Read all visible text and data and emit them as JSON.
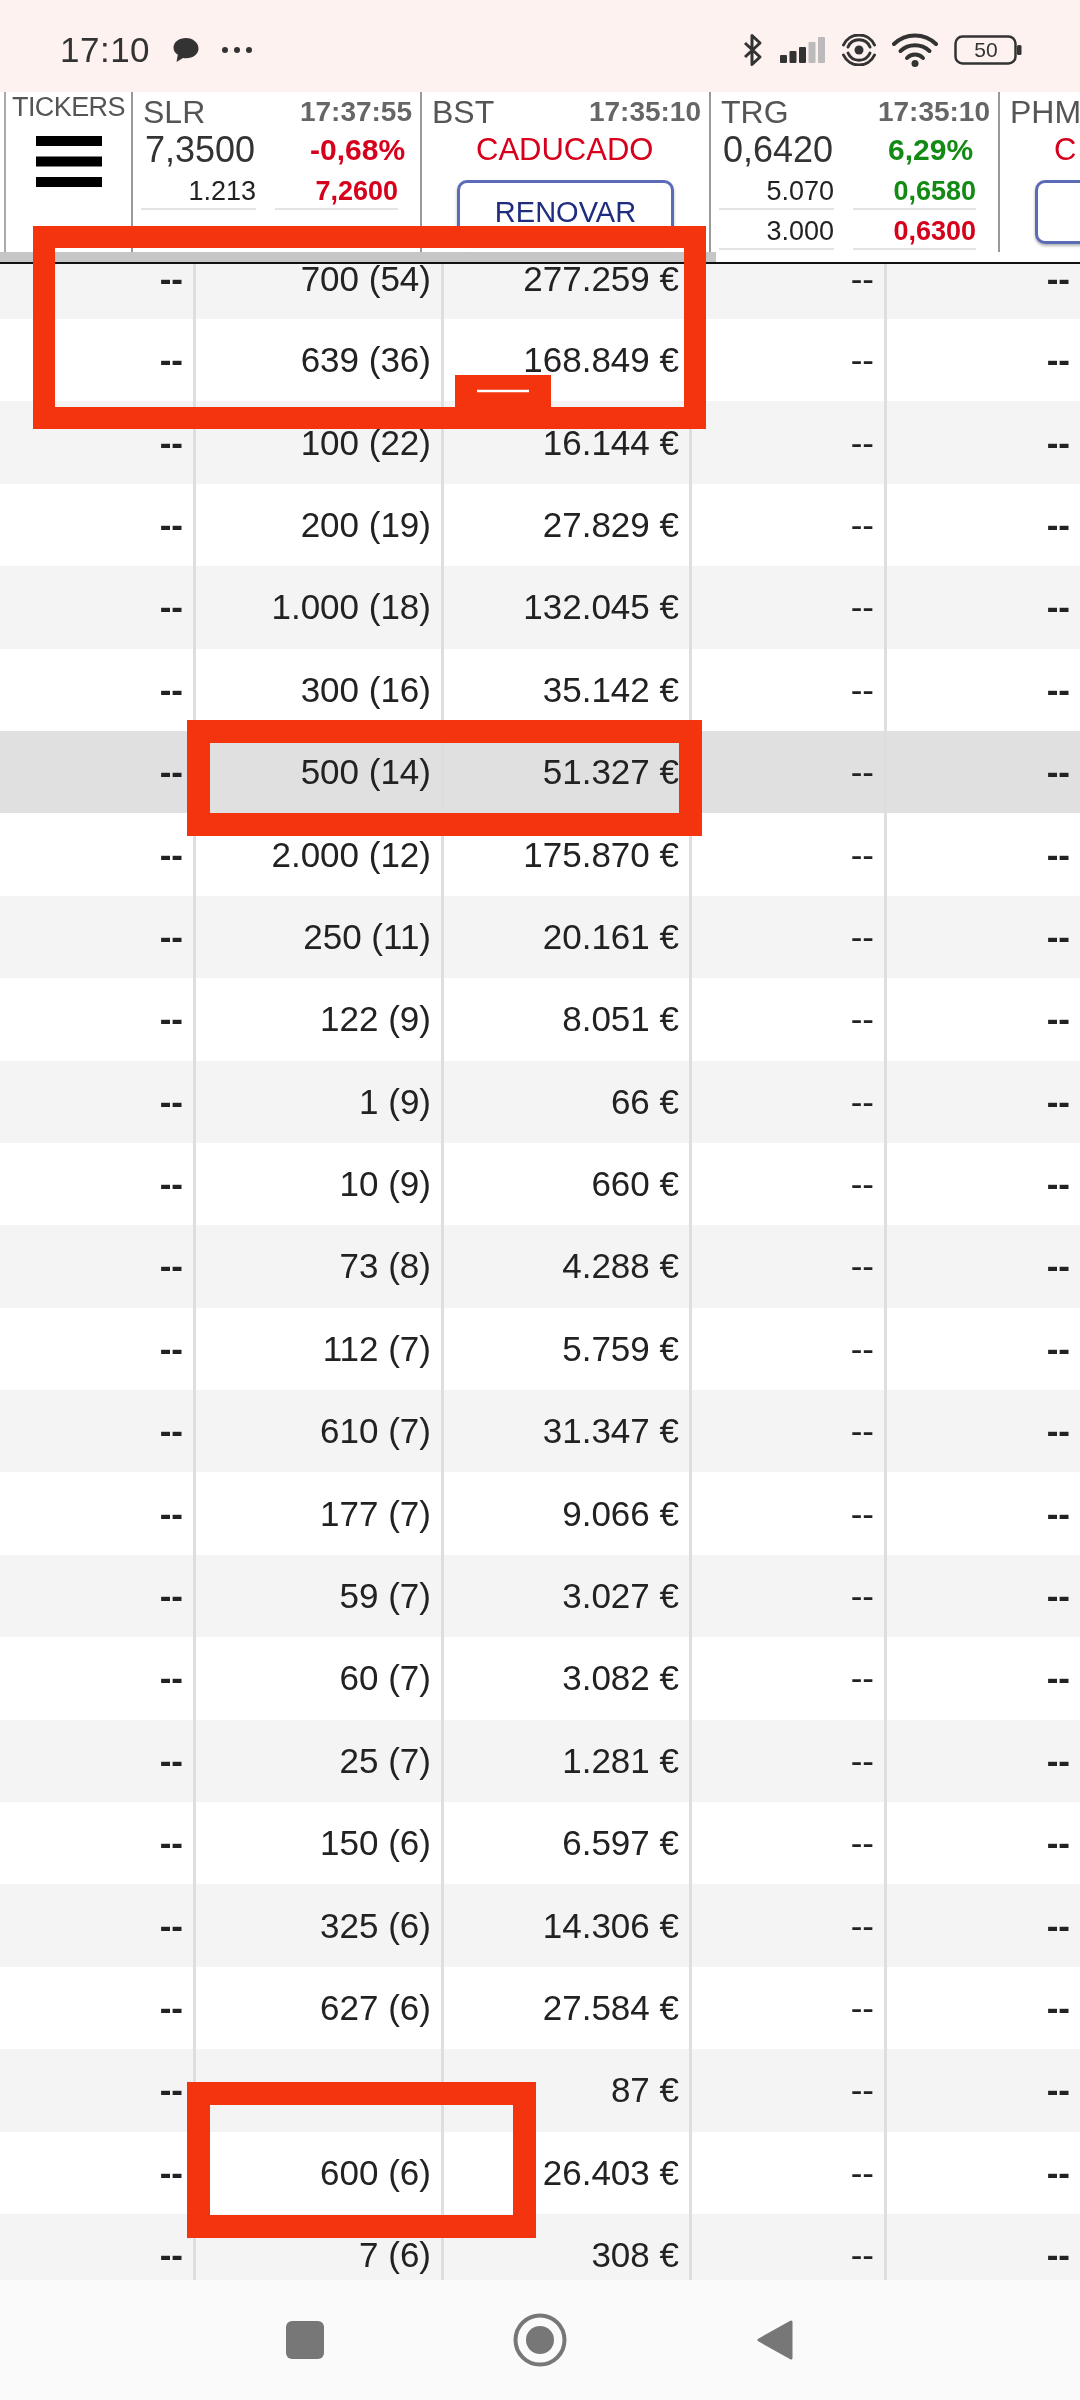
{
  "status_bar": {
    "time": "17:10",
    "battery": "50"
  },
  "ticker_bar": {
    "label": "TICKERS",
    "tickers": [
      {
        "kind": "quote",
        "symbol": "SLR",
        "time": "17:37:55",
        "price": "7,3500",
        "change": {
          "text": "-0,68%",
          "color": "#d6001c"
        },
        "levels": [
          {
            "volume": "1.213",
            "price": "7,2600",
            "color": "#d6001c"
          }
        ]
      },
      {
        "kind": "expired",
        "symbol": "BST",
        "time": "17:35:10",
        "status": "CADUCADO",
        "button": "RENOVAR"
      },
      {
        "kind": "quote",
        "symbol": "TRG",
        "time": "17:35:10",
        "price": "0,6420",
        "change": {
          "text": "6,29%",
          "color": "#138a13"
        },
        "levels": [
          {
            "volume": "5.070",
            "price": "0,6580",
            "color": "#138a13"
          },
          {
            "volume": "3.000",
            "price": "0,6300",
            "color": "#d6001c"
          }
        ]
      },
      {
        "kind": "expired",
        "symbol": "PHM",
        "status": "C"
      }
    ]
  },
  "table": {
    "rows": [
      {
        "column_1": "--",
        "column_2": "700 (54)",
        "column_3": "277.259 €",
        "column_4": "--",
        "column_5": "--",
        "selected": false
      },
      {
        "column_1": "--",
        "column_2": "639 (36)",
        "column_3": "168.849 €",
        "column_4": "--",
        "column_5": "--",
        "selected": false
      },
      {
        "column_1": "--",
        "column_2": "100 (22)",
        "column_3": "16.144 €",
        "column_4": "--",
        "column_5": "--",
        "selected": false
      },
      {
        "column_1": "--",
        "column_2": "200 (19)",
        "column_3": "27.829 €",
        "column_4": "--",
        "column_5": "--",
        "selected": false
      },
      {
        "column_1": "--",
        "column_2": "1.000 (18)",
        "column_3": "132.045 €",
        "column_4": "--",
        "column_5": "--",
        "selected": false
      },
      {
        "column_1": "--",
        "column_2": "300 (16)",
        "column_3": "35.142 €",
        "column_4": "--",
        "column_5": "--",
        "selected": false
      },
      {
        "column_1": "--",
        "column_2": "500 (14)",
        "column_3": "51.327 €",
        "column_4": "--",
        "column_5": "--",
        "selected": true
      },
      {
        "column_1": "--",
        "column_2": "2.000 (12)",
        "column_3": "175.870 €",
        "column_4": "--",
        "column_5": "--",
        "selected": false
      },
      {
        "column_1": "--",
        "column_2": "250 (11)",
        "column_3": "20.161 €",
        "column_4": "--",
        "column_5": "--",
        "selected": false
      },
      {
        "column_1": "--",
        "column_2": "122 (9)",
        "column_3": "8.051 €",
        "column_4": "--",
        "column_5": "--",
        "selected": false
      },
      {
        "column_1": "--",
        "column_2": "1 (9)",
        "column_3": "66 €",
        "column_4": "--",
        "column_5": "--",
        "selected": false
      },
      {
        "column_1": "--",
        "column_2": "10 (9)",
        "column_3": "660 €",
        "column_4": "--",
        "column_5": "--",
        "selected": false
      },
      {
        "column_1": "--",
        "column_2": "73 (8)",
        "column_3": "4.288 €",
        "column_4": "--",
        "column_5": "--",
        "selected": false
      },
      {
        "column_1": "--",
        "column_2": "112 (7)",
        "column_3": "5.759 €",
        "column_4": "--",
        "column_5": "--",
        "selected": false
      },
      {
        "column_1": "--",
        "column_2": "610 (7)",
        "column_3": "31.347 €",
        "column_4": "--",
        "column_5": "--",
        "selected": false
      },
      {
        "column_1": "--",
        "column_2": "177 (7)",
        "column_3": "9.066 €",
        "column_4": "--",
        "column_5": "--",
        "selected": false
      },
      {
        "column_1": "--",
        "column_2": "59 (7)",
        "column_3": "3.027 €",
        "column_4": "--",
        "column_5": "--",
        "selected": false
      },
      {
        "column_1": "--",
        "column_2": "60 (7)",
        "column_3": "3.082 €",
        "column_4": "--",
        "column_5": "--",
        "selected": false
      },
      {
        "column_1": "--",
        "column_2": "25 (7)",
        "column_3": "1.281 €",
        "column_4": "--",
        "column_5": "--",
        "selected": false
      },
      {
        "column_1": "--",
        "column_2": "150 (6)",
        "column_3": "6.597 €",
        "column_4": "--",
        "column_5": "--",
        "selected": false
      },
      {
        "column_1": "--",
        "column_2": "325 (6)",
        "column_3": "14.306 €",
        "column_4": "--",
        "column_5": "--",
        "selected": false
      },
      {
        "column_1": "--",
        "column_2": "627 (6)",
        "column_3": "27.584 €",
        "column_4": "--",
        "column_5": "--",
        "selected": false
      },
      {
        "column_1": "--",
        "column_3": "87 €",
        "column_4": "--",
        "column_5": "--",
        "selected": false
      },
      {
        "column_1": "--",
        "column_2": "600 (6)",
        "column_3": "26.403 €",
        "column_4": "--",
        "column_5": "--",
        "selected": false
      },
      {
        "column_1": "--",
        "column_2": "7 (6)",
        "column_3": "308 €",
        "column_4": "--",
        "column_5": "--",
        "selected": false
      }
    ]
  }
}
